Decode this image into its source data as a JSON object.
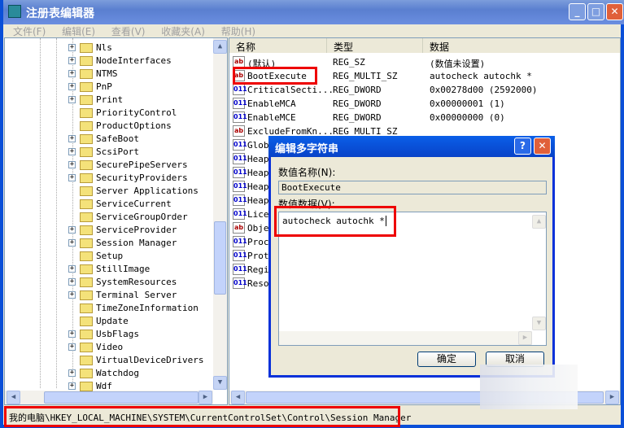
{
  "window": {
    "title": "注册表编辑器",
    "minimize": "_",
    "maximize": "□",
    "close": "✕"
  },
  "menu": [
    "文件(F)",
    "编辑(E)",
    "查看(V)",
    "收藏夹(A)",
    "帮助(H)"
  ],
  "tree": [
    {
      "label": "Nls",
      "expandable": true
    },
    {
      "label": "NodeInterfaces",
      "expandable": true
    },
    {
      "label": "NTMS",
      "expandable": true
    },
    {
      "label": "PnP",
      "expandable": true
    },
    {
      "label": "Print",
      "expandable": true
    },
    {
      "label": "PriorityControl",
      "expandable": false
    },
    {
      "label": "ProductOptions",
      "expandable": false
    },
    {
      "label": "SafeBoot",
      "expandable": true
    },
    {
      "label": "ScsiPort",
      "expandable": true
    },
    {
      "label": "SecurePipeServers",
      "expandable": true
    },
    {
      "label": "SecurityProviders",
      "expandable": true
    },
    {
      "label": "Server Applications",
      "expandable": false
    },
    {
      "label": "ServiceCurrent",
      "expandable": false
    },
    {
      "label": "ServiceGroupOrder",
      "expandable": false
    },
    {
      "label": "ServiceProvider",
      "expandable": true
    },
    {
      "label": "Session Manager",
      "expandable": true,
      "selected": true
    },
    {
      "label": "Setup",
      "expandable": false
    },
    {
      "label": "StillImage",
      "expandable": true
    },
    {
      "label": "SystemResources",
      "expandable": true
    },
    {
      "label": "Terminal Server",
      "expandable": true
    },
    {
      "label": "TimeZoneInformation",
      "expandable": false
    },
    {
      "label": "Update",
      "expandable": false
    },
    {
      "label": "UsbFlags",
      "expandable": true
    },
    {
      "label": "Video",
      "expandable": true
    },
    {
      "label": "VirtualDeviceDrivers",
      "expandable": false
    },
    {
      "label": "Watchdog",
      "expandable": true
    },
    {
      "label": "Wdf",
      "expandable": true
    }
  ],
  "list": {
    "headers": [
      "名称",
      "类型",
      "数据"
    ],
    "rows": [
      {
        "icon": "ab",
        "name": "(默认)",
        "type": "REG_SZ",
        "data": "(数值未设置)"
      },
      {
        "icon": "ab",
        "name": "BootExecute",
        "type": "REG_MULTI_SZ",
        "data": "autocheck autochk *"
      },
      {
        "icon": "bin",
        "name": "CriticalSecti...",
        "type": "REG_DWORD",
        "data": "0x00278d00 (2592000)"
      },
      {
        "icon": "bin",
        "name": "EnableMCA",
        "type": "REG_DWORD",
        "data": "0x00000001 (1)"
      },
      {
        "icon": "bin",
        "name": "EnableMCE",
        "type": "REG_DWORD",
        "data": "0x00000000 (0)"
      },
      {
        "icon": "ab",
        "name": "ExcludeFromKn...",
        "type": "REG_MULTI_SZ",
        "data": ""
      },
      {
        "icon": "bin",
        "name": "Glob",
        "type": "",
        "data": ""
      },
      {
        "icon": "bin",
        "name": "Heap",
        "type": "",
        "data": ""
      },
      {
        "icon": "bin",
        "name": "Heap",
        "type": "",
        "data": ""
      },
      {
        "icon": "bin",
        "name": "Heap",
        "type": "",
        "data": ""
      },
      {
        "icon": "bin",
        "name": "Heap",
        "type": "",
        "data": ""
      },
      {
        "icon": "bin",
        "name": "Lice",
        "type": "",
        "data": ""
      },
      {
        "icon": "ab",
        "name": "Obje",
        "type": "",
        "data": ""
      },
      {
        "icon": "bin",
        "name": "Proc",
        "type": "",
        "data": ""
      },
      {
        "icon": "bin",
        "name": "Prot",
        "type": "",
        "data": ""
      },
      {
        "icon": "bin",
        "name": "Regi",
        "type": "",
        "data": ""
      },
      {
        "icon": "bin",
        "name": "Reso",
        "type": "",
        "data": ""
      }
    ]
  },
  "dialog": {
    "title": "编辑多字符串",
    "help": "?",
    "close": "✕",
    "name_label": "数值名称(N):",
    "name_value": "BootExecute",
    "data_label": "数值数据(V):",
    "data_value": "autocheck autochk *",
    "ok": "确定",
    "cancel": "取消"
  },
  "status": "我的电脑\\HKEY_LOCAL_MACHINE\\SYSTEM\\CurrentControlSet\\Control\\Session Manager"
}
